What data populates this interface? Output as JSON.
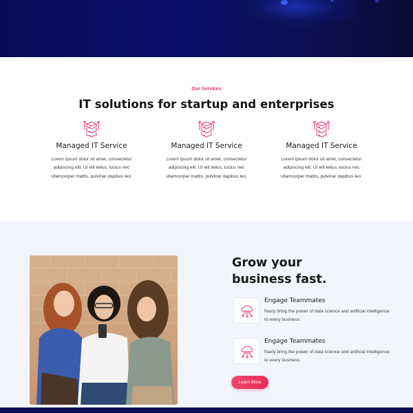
{
  "services": {
    "eyebrow": "Our Services",
    "title": "IT solutions for startup and enterprises",
    "cards": [
      {
        "icon": "server-stack-icon",
        "title": "Managed IT Service",
        "text": "Lorem ipsum dolor sit amet, consectetur adipiscing elit. Ut elit tellus, luctus nec ullamcorper mattis, pulvinar dapibus leo."
      },
      {
        "icon": "server-stack-icon",
        "title": "Managed IT Service",
        "text": "Lorem ipsum dolor sit amet, consectetur adipiscing elit. Ut elit tellus, luctus nec ullamcorper mattis, pulvinar dapibus leo."
      },
      {
        "icon": "server-stack-icon",
        "title": "Managed IT Service",
        "text": "Lorem ipsum dolor sit amet, consectetur adipiscing elit. Ut elit tellus, luctus nec ullamcorper mattis, pulvinar dapibus leo."
      }
    ]
  },
  "grow": {
    "title_line1": "Grow your",
    "title_line2": "business fast.",
    "features": [
      {
        "icon": "cloud-network-icon",
        "title": "Engage Teammates",
        "text": "Naxly bring the power of data science and artificial intelligence to every business."
      },
      {
        "icon": "cloud-network-icon",
        "title": "Engage Teammates",
        "text": "Naxly bring the power of data science and artificial intelligence to every business."
      }
    ],
    "button_label": "Learn More",
    "photo": "three-women-looking-at-phone-image"
  },
  "colors": {
    "accent": "#e8386b",
    "hero": "#0a0f6b",
    "section_bg": "#f2f5fb"
  }
}
